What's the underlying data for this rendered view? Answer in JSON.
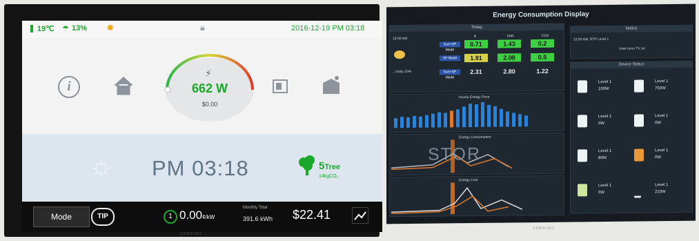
{
  "left_display": {
    "status": {
      "temperature": "19℃",
      "humidity": "13%",
      "datetime": "2016-12-19 PM 03:18"
    },
    "power": {
      "watts": "662 W",
      "cost": "$0.00"
    },
    "clock": "PM 03:18",
    "tree": {
      "count": "5",
      "unit": "Tree",
      "co2": "14kgCO₂"
    },
    "bottom": {
      "mode_label": "Mode",
      "tip_label": "TIP",
      "rate_value": "0.00",
      "rate_unit": "¢/kW",
      "rate_tier": "1",
      "monthly_label": "Monthly Total",
      "monthly_value": "391.6 kWh",
      "bill": "$22.41"
    },
    "brand": "SAMSUNG"
  },
  "right_display": {
    "title": "Energy Consumption Display",
    "today": {
      "header": "Today",
      "time": "10:00 AM",
      "humidity": "...nidity  20%",
      "col_headers": [
        "$",
        "kWh",
        "CO2"
      ],
      "rows": [
        {
          "mode": "Sun+SP Mode",
          "values": [
            "0.71",
            "1.43",
            "0.2"
          ]
        },
        {
          "mode": "SP Mode",
          "values": [
            "1.91",
            "2.08",
            "0.5"
          ]
        },
        {
          "mode": "Sun+SP Mode",
          "values": [
            "2.31",
            "2.80",
            "1.22"
          ]
        }
      ]
    },
    "charts": [
      {
        "title": "Hourly Energy Price"
      },
      {
        "title": "Energy Consumption"
      },
      {
        "title": "Energy Cost"
      }
    ],
    "overlay_text": "STOR",
    "notice": {
      "header": "Notice",
      "line1": "10:00 AM, RTP Level 1",
      "line2": "User turns TV on"
    },
    "device_status": {
      "header": "Device Status",
      "devices": [
        {
          "level": "Level 1",
          "watts": "100W"
        },
        {
          "level": "Level 1",
          "watts": "750W"
        },
        {
          "level": "Level 1",
          "watts": "0W"
        },
        {
          "level": "Level 1",
          "watts": "0W"
        },
        {
          "level": "Level 1",
          "watts": "80W"
        },
        {
          "level": "Level 1",
          "watts": "0W"
        },
        {
          "level": "Level 1",
          "watts": "0W"
        },
        {
          "level": "Level 1",
          "watts": "210W"
        }
      ]
    },
    "brand": "SAMSUNG"
  },
  "colors": {
    "accent_green": "#1aa82a",
    "bar_blue": "#2a83d8",
    "highlight_orange": "#e07a2b"
  }
}
